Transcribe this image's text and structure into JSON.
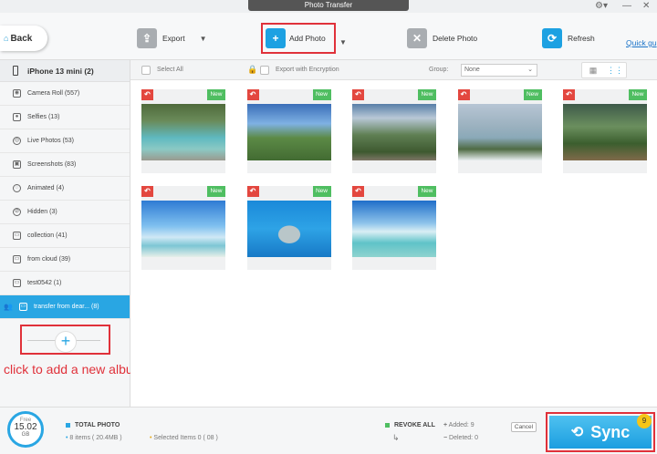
{
  "window": {
    "title": "Photo Transfer"
  },
  "toolbar": {
    "back_label": "Back",
    "export_label": "Export",
    "add_photo_label": "Add Photo",
    "delete_photo_label": "Delete Photo",
    "refresh_label": "Refresh",
    "quick_guide_label": "Quick gu"
  },
  "sidebar": {
    "device": "iPhone 13 mini (2)",
    "albums": [
      {
        "label": "Camera Roll (557)",
        "icon": "camera-icon"
      },
      {
        "label": "Selfies (13)",
        "icon": "person-icon"
      },
      {
        "label": "Live Photos (53)",
        "icon": "live-icon"
      },
      {
        "label": "Screenshots (83)",
        "icon": "screenshot-icon"
      },
      {
        "label": "Animated (4)",
        "icon": "animated-icon"
      },
      {
        "label": "Hidden (3)",
        "icon": "hidden-icon"
      },
      {
        "label": "collection (41)",
        "icon": "album-icon"
      },
      {
        "label": "from cloud (39)",
        "icon": "album-icon"
      },
      {
        "label": "test0542 (1)",
        "icon": "album-icon"
      },
      {
        "label": "transfer from dear... (8)",
        "icon": "album-icon"
      }
    ],
    "add_album_caption": "click to add a new album"
  },
  "filterbar": {
    "select_all": "Select All",
    "export_encryption": "Export with Encryption",
    "group_label": "Group:",
    "group_value": "None"
  },
  "photos": [
    {
      "badge": "New",
      "theme": "p1"
    },
    {
      "badge": "New",
      "theme": "p2"
    },
    {
      "badge": "New",
      "theme": "p3"
    },
    {
      "badge": "New",
      "theme": "p4"
    },
    {
      "badge": "New",
      "theme": "p5"
    },
    {
      "badge": "New",
      "theme": "p6"
    },
    {
      "badge": "New",
      "theme": "p7"
    },
    {
      "badge": "New",
      "theme": "p8"
    }
  ],
  "bottom": {
    "storage_free_label": "Free",
    "storage_value": "15.02",
    "storage_unit": "GB",
    "total_photo_label": "TOTAL PHOTO",
    "items_text": "8 items ( 20.4MB )",
    "selected_text": "Selected Items 0 ( 08 )",
    "revoke_all_label": "REVOKE ALL",
    "added_text": "Added: 9",
    "deleted_text": "Deleted: 0",
    "cancel_label": "Cancel",
    "sync_label": "Sync",
    "sync_badge": "9"
  },
  "colors": {
    "accent": "#29a6e3",
    "highlight": "#e0313a",
    "new_badge": "#4fbe61",
    "revoke": "#e3473f"
  }
}
